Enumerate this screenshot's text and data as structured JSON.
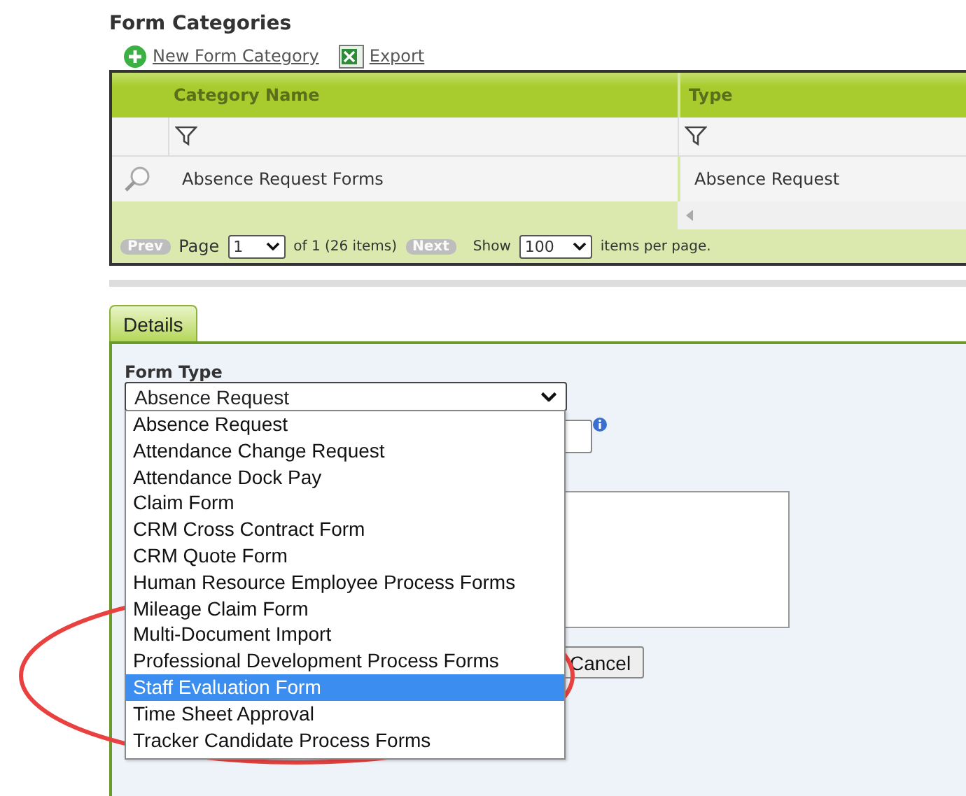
{
  "title": "Form Categories",
  "toolbar": [
    {
      "kind": "add",
      "label": "New Form Category"
    },
    {
      "kind": "excel",
      "label": "Export"
    }
  ],
  "grid": {
    "columns": [
      "Category Name",
      "Type"
    ],
    "rows": [
      [
        "Absence Request Forms",
        "Absence Request"
      ]
    ],
    "pager": {
      "prev": {
        "label": "Prev",
        "disabled": true
      },
      "page_label": "Page",
      "page": "1",
      "of_text": "of 1 (26 items)",
      "next": {
        "label": "Next",
        "disabled": true
      },
      "show_label": "Show",
      "page_size": "100",
      "per_page_label": "items per page."
    }
  },
  "tabs": [
    {
      "label": "Details",
      "selected": true
    }
  ],
  "form": {
    "form_type_label": "Form Type",
    "form_type_value": "Absence Request",
    "options": [
      {
        "label": "Absence Request",
        "selected": false
      },
      {
        "label": "Attendance Change Request",
        "selected": false
      },
      {
        "label": "Attendance Dock Pay",
        "selected": false
      },
      {
        "label": "Claim Form",
        "selected": false
      },
      {
        "label": "CRM Cross Contract Form",
        "selected": false
      },
      {
        "label": "CRM Quote Form",
        "selected": false
      },
      {
        "label": "Human Resource Employee Process Forms",
        "selected": false
      },
      {
        "label": "Mileage Claim Form",
        "selected": false
      },
      {
        "label": "Multi-Document Import",
        "selected": false
      },
      {
        "label": "Professional Development Process Forms",
        "selected": false
      },
      {
        "label": "Staff Evaluation Form",
        "selected": true
      },
      {
        "label": "Time Sheet Approval",
        "selected": false
      },
      {
        "label": "Tracker Candidate Process Forms",
        "selected": false
      }
    ],
    "cancel_button": "Cancel"
  }
}
